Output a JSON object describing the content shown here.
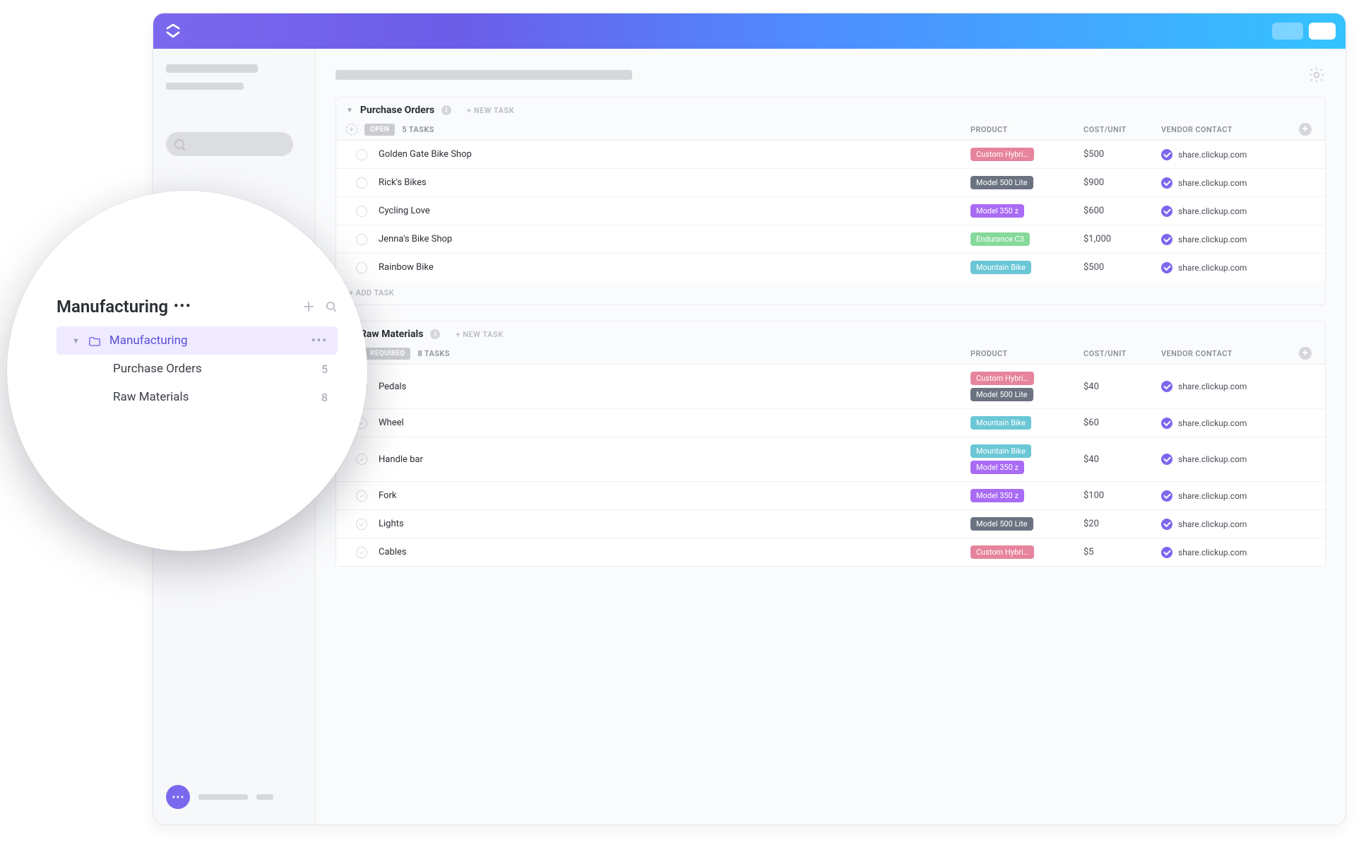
{
  "titlebar": {
    "logo_alt": "ClickUp"
  },
  "settings": {
    "gear_alt": "Settings"
  },
  "groups": {
    "purchase_orders": {
      "title": "Purchase Orders",
      "new_task": "+ NEW TASK",
      "status_label": "OPEN",
      "task_count": "5 TASKS",
      "add_task": "+ ADD TASK",
      "columns": {
        "product": "PRODUCT",
        "cost": "COST/UNIT",
        "vendor": "VENDOR CONTACT"
      },
      "rows": [
        {
          "name": "Golden Gate Bike Shop",
          "tags": [
            {
              "label": "Custom Hybri…",
              "color": "#e7849d"
            }
          ],
          "cost": "$500",
          "vendor": "share.clickup.com"
        },
        {
          "name": "Rick's Bikes",
          "tags": [
            {
              "label": "Model 500 Lite",
              "color": "#6b7280"
            }
          ],
          "cost": "$900",
          "vendor": "share.clickup.com"
        },
        {
          "name": "Cycling Love",
          "tags": [
            {
              "label": "Model 350 z",
              "color": "#a96bf4"
            }
          ],
          "cost": "$600",
          "vendor": "share.clickup.com"
        },
        {
          "name": "Jenna's Bike Shop",
          "tags": [
            {
              "label": "Endurance C3",
              "color": "#86d99a"
            }
          ],
          "cost": "$1,000",
          "vendor": "share.clickup.com"
        },
        {
          "name": "Rainbow Bike",
          "tags": [
            {
              "label": "Mountain Bike",
              "color": "#6bc7d6"
            }
          ],
          "cost": "$500",
          "vendor": "share.clickup.com"
        }
      ]
    },
    "raw_materials": {
      "title": "Raw Materials",
      "new_task": "+ NEW TASK",
      "status_label": "REQUIRED",
      "task_count": "8 TASKS",
      "columns": {
        "product": "PRODUCT",
        "cost": "COST/UNIT",
        "vendor": "VENDOR CONTACT"
      },
      "rows": [
        {
          "name": "Pedals",
          "tags": [
            {
              "label": "Custom Hybri…",
              "color": "#e7849d"
            },
            {
              "label": "Model 500 Lite",
              "color": "#6b7280"
            }
          ],
          "cost": "$40",
          "vendor": "share.clickup.com"
        },
        {
          "name": "Wheel",
          "tags": [
            {
              "label": "Mountain Bike",
              "color": "#6bc7d6"
            }
          ],
          "cost": "$60",
          "vendor": "share.clickup.com"
        },
        {
          "name": "Handle bar",
          "tags": [
            {
              "label": "Mountain Bike",
              "color": "#6bc7d6"
            },
            {
              "label": "Model 350 z",
              "color": "#a96bf4"
            }
          ],
          "cost": "$40",
          "vendor": "share.clickup.com"
        },
        {
          "name": "Fork",
          "tags": [
            {
              "label": "Model 350 z",
              "color": "#a96bf4"
            }
          ],
          "cost": "$100",
          "vendor": "share.clickup.com"
        },
        {
          "name": "Lights",
          "tags": [
            {
              "label": "Model 500 Lite",
              "color": "#6b7280"
            }
          ],
          "cost": "$20",
          "vendor": "share.clickup.com"
        },
        {
          "name": "Cables",
          "tags": [
            {
              "label": "Custom Hybri…",
              "color": "#e7849d"
            }
          ],
          "cost": "$5",
          "vendor": "share.clickup.com"
        }
      ]
    }
  },
  "zoom": {
    "title": "Manufacturing",
    "folder": {
      "label": "Manufacturing"
    },
    "lists": [
      {
        "label": "Purchase Orders",
        "count": "5"
      },
      {
        "label": "Raw Materials",
        "count": "8"
      }
    ]
  }
}
